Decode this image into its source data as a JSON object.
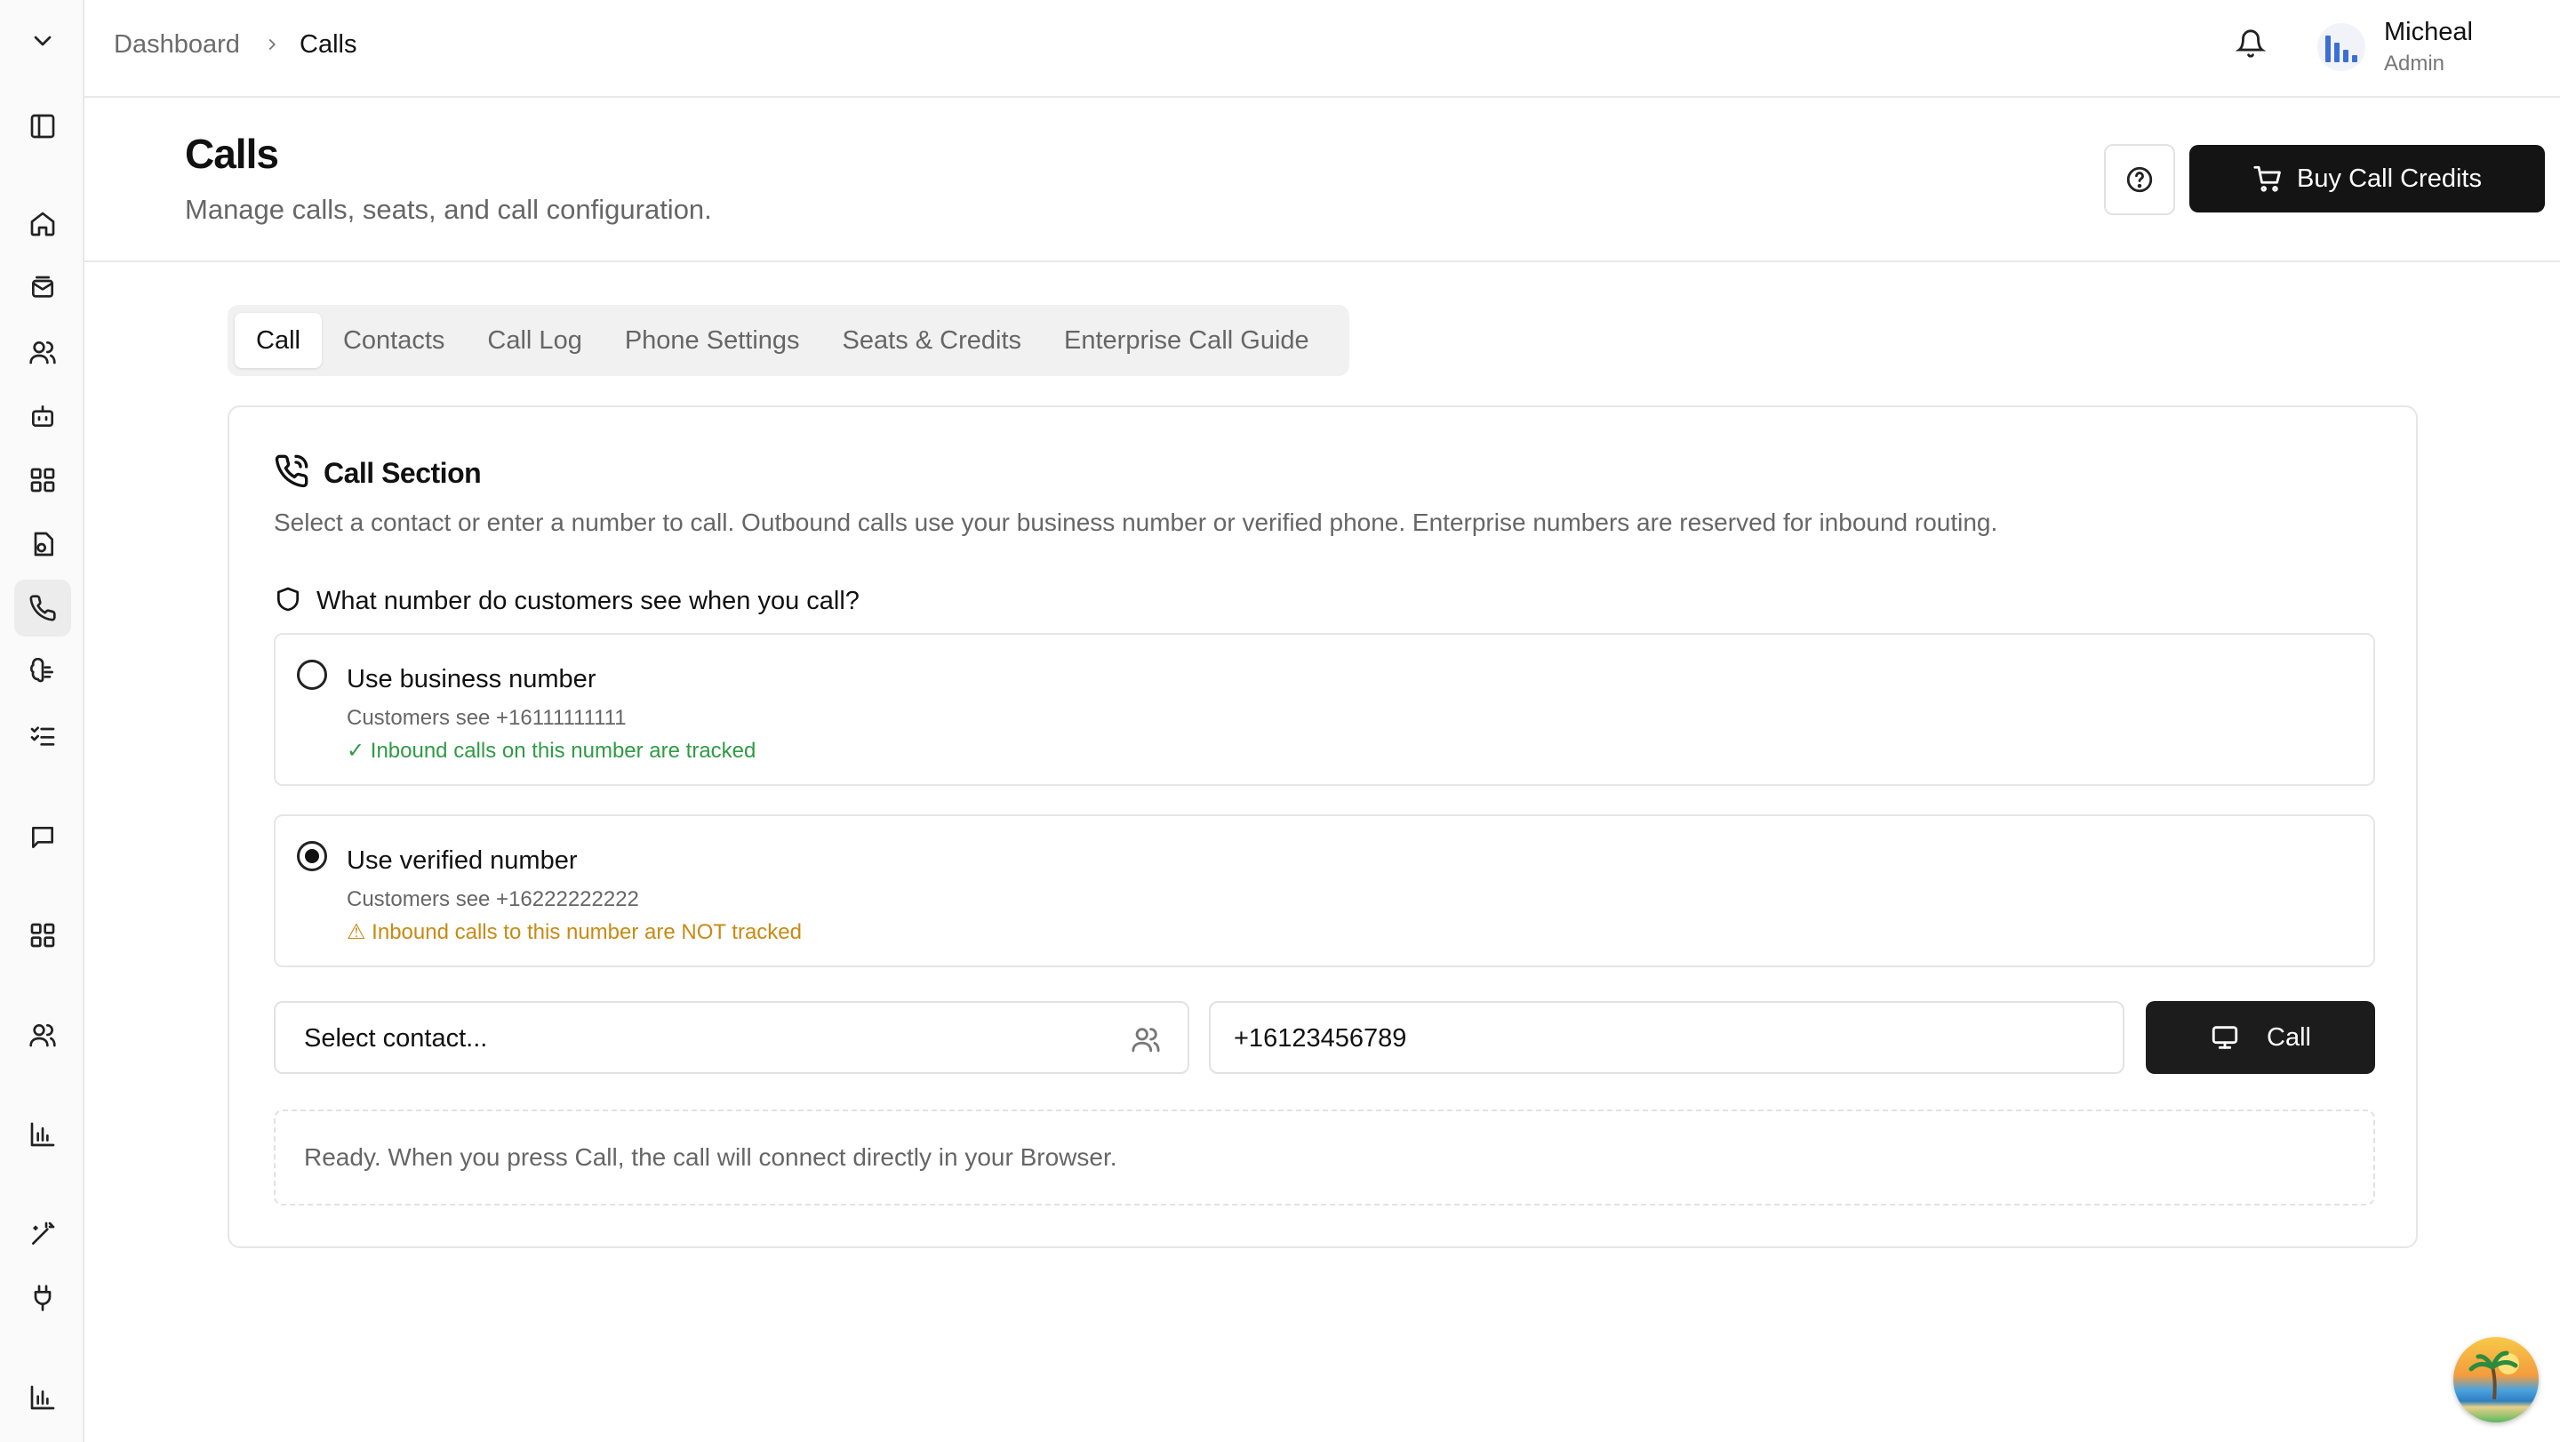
{
  "breadcrumb": {
    "root": "Dashboard",
    "current": "Calls"
  },
  "user": {
    "name": "Micheal",
    "role": "Admin"
  },
  "header": {
    "title": "Calls",
    "subtitle": "Manage calls, seats, and call configuration.",
    "buy_label": "Buy Call Credits"
  },
  "tabs": [
    {
      "label": "Call",
      "active": true
    },
    {
      "label": "Contacts"
    },
    {
      "label": "Call Log"
    },
    {
      "label": "Phone Settings"
    },
    {
      "label": "Seats & Credits"
    },
    {
      "label": "Enterprise Call Guide"
    }
  ],
  "call_section": {
    "title": "Call Section",
    "description": "Select a contact or enter a number to call. Outbound calls use your business number or verified phone. Enterprise numbers are reserved for inbound routing.",
    "question": "What number do customers see when you call?",
    "options": [
      {
        "title": "Use business number",
        "sub": "Customers see +16111111111",
        "note": "✓ Inbound calls on this number are tracked",
        "selected": false
      },
      {
        "title": "Use verified number",
        "sub": "Customers see +16222222222",
        "note": "⚠ Inbound calls to this number are NOT tracked",
        "selected": true
      }
    ],
    "contact_placeholder": "Select contact...",
    "phone_value": "+16123456789",
    "call_label": "Call",
    "status": "Ready. When you press Call, the call will connect directly in your Browser."
  },
  "colors": {
    "accent": "#141414",
    "tracked": "#2f9b45",
    "not_tracked": "#c98a12"
  },
  "icons": {
    "sidebar": [
      "chevron-down-icon",
      "panel-icon",
      "home-icon",
      "mail-icon",
      "users-icon",
      "bot-icon",
      "grid-icon",
      "file-icon",
      "phone-icon",
      "brain-icon",
      "checklist-icon",
      "message-icon",
      "apps-icon",
      "contacts-icon",
      "bar-chart-icon",
      "magic-wand-icon",
      "plug-icon",
      "analytics-icon"
    ]
  }
}
